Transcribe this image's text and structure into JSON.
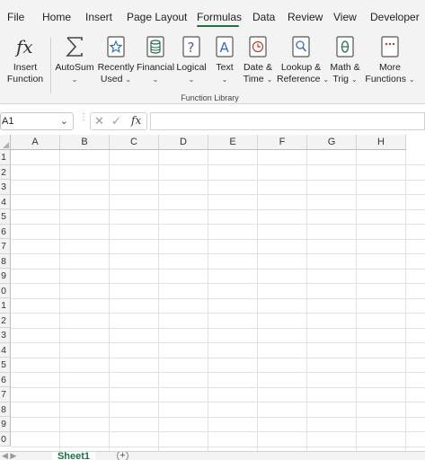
{
  "menu": {
    "tabs": [
      {
        "label": "File"
      },
      {
        "label": "Home"
      },
      {
        "label": "Insert"
      },
      {
        "label": "Page Layout"
      },
      {
        "label": "Formulas"
      },
      {
        "label": "Data"
      },
      {
        "label": "Review"
      },
      {
        "label": "View"
      },
      {
        "label": "Developer"
      }
    ],
    "active_tab": "Formulas",
    "accent_color": "#1e7145"
  },
  "ribbon": {
    "insert_function": {
      "line1": "Insert",
      "line2": "Function",
      "icon": "fx-icon"
    },
    "autosum": {
      "line1": "AutoSum",
      "chevron": "⌄",
      "icon": "sigma-icon"
    },
    "recently_used": {
      "line1": "Recently",
      "line2": "Used",
      "chevron": "⌄",
      "icon": "star-book-icon"
    },
    "financial": {
      "line1": "Financial",
      "chevron": "⌄",
      "icon": "coins-book-icon"
    },
    "logical": {
      "line1": "Logical",
      "chevron": "⌄",
      "icon": "question-book-icon"
    },
    "text": {
      "line1": "Text",
      "chevron": "⌄",
      "icon": "letter-a-book-icon"
    },
    "date_time": {
      "line1": "Date &",
      "line2": "Time",
      "chevron": "⌄",
      "icon": "clock-book-icon"
    },
    "lookup_reference": {
      "line1": "Lookup &",
      "line2": "Reference",
      "chevron": "⌄",
      "icon": "magnifier-book-icon"
    },
    "math_trig": {
      "line1": "Math &",
      "line2": "Trig",
      "chevron": "⌄",
      "icon": "theta-book-icon"
    },
    "more_functions": {
      "line1": "More",
      "line2": "Functions",
      "chevron": "⌄",
      "icon": "more-book-icon"
    },
    "group_label": "Function Library"
  },
  "formula_bar": {
    "name_box": "A1",
    "name_box_caret": "⌄",
    "cancel_glyph": "✕",
    "enter_glyph": "✓",
    "fx_glyph": "fx",
    "formula_value": ""
  },
  "grid": {
    "columns": [
      "A",
      "B",
      "C",
      "D",
      "E",
      "F",
      "G",
      "H"
    ],
    "rows": [
      "1",
      "2",
      "3",
      "4",
      "5",
      "6",
      "7",
      "8",
      "9",
      "0",
      "1",
      "2",
      "3",
      "4",
      "5",
      "6",
      "7",
      "8",
      "9",
      "0"
    ]
  },
  "sheets": {
    "tabs": [
      {
        "label": "Sheet1"
      }
    ],
    "add_glyph": "+"
  }
}
